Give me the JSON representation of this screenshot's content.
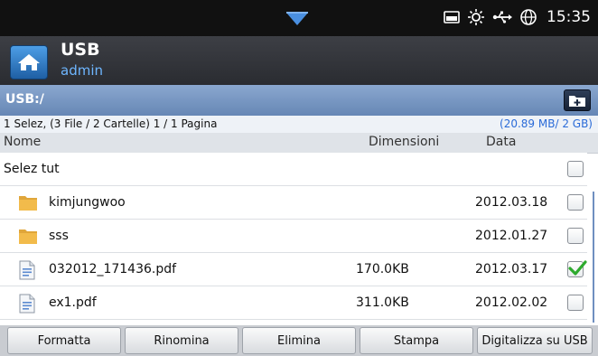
{
  "status_bar": {
    "time": "15:35",
    "icons": [
      "dropdown-tab-icon",
      "toner-icon",
      "sun-icon",
      "usb-icon",
      "globe-icon"
    ]
  },
  "header": {
    "title": "USB",
    "subtitle": "admin"
  },
  "path_bar": {
    "path": "USB:/"
  },
  "info_bar": {
    "selection_summary": "1 Selez, (3 File / 2 Cartelle) 1 / 1 Pagina",
    "storage": "(20.89 MB/ 2 GB)"
  },
  "columns": {
    "name": "Nome",
    "size": "Dimensioni",
    "date": "Data"
  },
  "select_all": {
    "label": "Selez tut",
    "checked": false
  },
  "files": [
    {
      "name": "kimjungwoo",
      "type": "folder",
      "size": "",
      "date": "2012.03.18",
      "checked": false
    },
    {
      "name": "sss",
      "type": "folder",
      "size": "",
      "date": "2012.01.27",
      "checked": false
    },
    {
      "name": "032012_171436.pdf",
      "type": "file",
      "size": "170.0KB",
      "date": "2012.03.17",
      "checked": true
    },
    {
      "name": "ex1.pdf",
      "type": "file",
      "size": "311.0KB",
      "date": "2012.02.02",
      "checked": false
    }
  ],
  "buttons": {
    "format": "Formatta",
    "rename": "Rinomina",
    "delete": "Elimina",
    "print": "Stampa",
    "scan": "Digitalizza su USB"
  },
  "colors": {
    "status_bar": "#111111",
    "header": "#2f3136",
    "home_button": "#2f7fd1",
    "path_bar": "#7796c2",
    "check_green": "#2eaa2e",
    "link_blue": "#2a6bd8"
  }
}
